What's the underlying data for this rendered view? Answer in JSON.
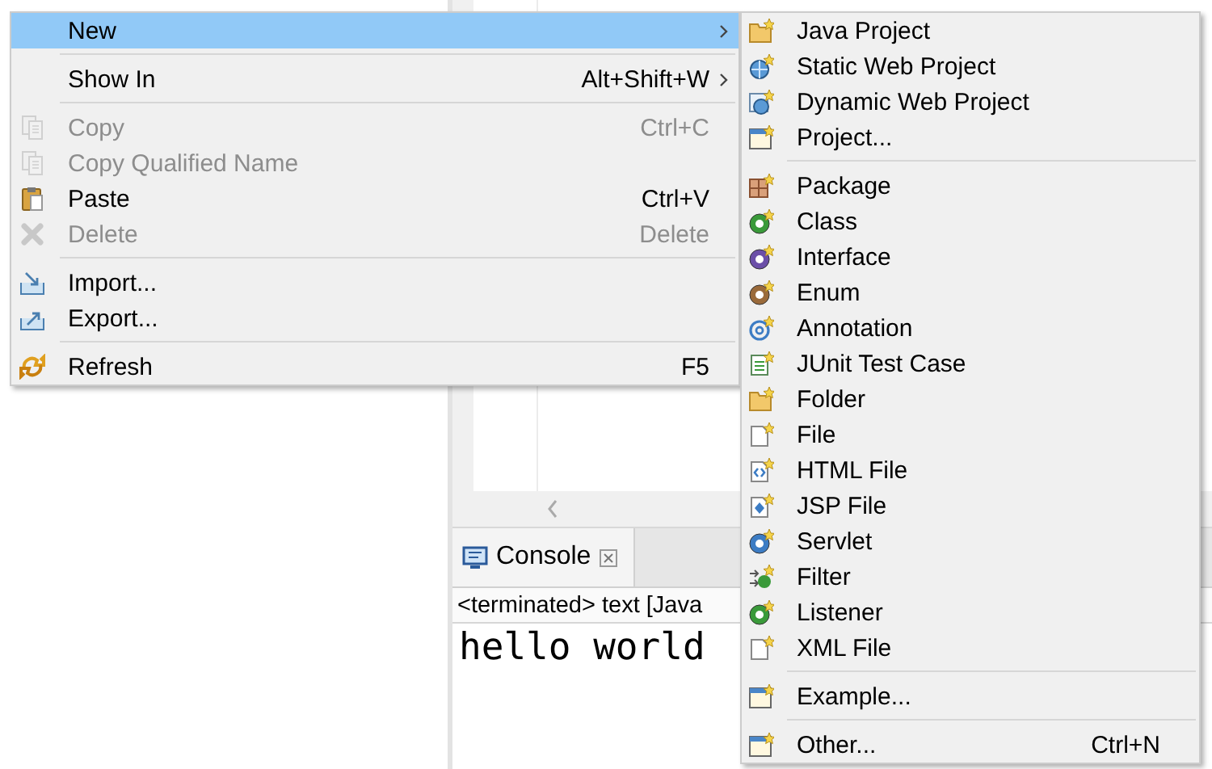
{
  "menu": {
    "items": [
      {
        "kind": "item",
        "label": "New",
        "submenu": true,
        "selected": true,
        "disabled": false
      },
      {
        "kind": "separator"
      },
      {
        "kind": "item",
        "label": "Show In",
        "shortcut": "Alt+Shift+W",
        "submenu": true,
        "selected": false,
        "disabled": false
      },
      {
        "kind": "separator"
      },
      {
        "kind": "item",
        "label": "Copy",
        "shortcut": "Ctrl+C",
        "submenu": false,
        "selected": false,
        "disabled": true
      },
      {
        "kind": "item",
        "label": "Copy Qualified Name",
        "submenu": false,
        "selected": false,
        "disabled": true
      },
      {
        "kind": "item",
        "label": "Paste",
        "shortcut": "Ctrl+V",
        "submenu": false,
        "selected": false,
        "disabled": false
      },
      {
        "kind": "item",
        "label": "Delete",
        "shortcut": "Delete",
        "submenu": false,
        "selected": false,
        "disabled": true
      },
      {
        "kind": "separator"
      },
      {
        "kind": "item",
        "label": "Import...",
        "submenu": false,
        "selected": false,
        "disabled": false
      },
      {
        "kind": "item",
        "label": "Export...",
        "submenu": false,
        "selected": false,
        "disabled": false
      },
      {
        "kind": "separator"
      },
      {
        "kind": "item",
        "label": "Refresh",
        "shortcut": "F5",
        "submenu": false,
        "selected": false,
        "disabled": false
      }
    ]
  },
  "submenu": {
    "items": [
      {
        "kind": "item",
        "label": "Java Project"
      },
      {
        "kind": "item",
        "label": "Static Web Project"
      },
      {
        "kind": "item",
        "label": "Dynamic Web Project"
      },
      {
        "kind": "item",
        "label": "Project..."
      },
      {
        "kind": "separator"
      },
      {
        "kind": "item",
        "label": "Package"
      },
      {
        "kind": "item",
        "label": "Class"
      },
      {
        "kind": "item",
        "label": "Interface"
      },
      {
        "kind": "item",
        "label": "Enum"
      },
      {
        "kind": "item",
        "label": "Annotation"
      },
      {
        "kind": "item",
        "label": "JUnit Test Case"
      },
      {
        "kind": "item",
        "label": "Folder"
      },
      {
        "kind": "item",
        "label": "File"
      },
      {
        "kind": "item",
        "label": "HTML File"
      },
      {
        "kind": "item",
        "label": "JSP File"
      },
      {
        "kind": "item",
        "label": "Servlet"
      },
      {
        "kind": "item",
        "label": "Filter"
      },
      {
        "kind": "item",
        "label": "Listener"
      },
      {
        "kind": "item",
        "label": "XML File"
      },
      {
        "kind": "separator"
      },
      {
        "kind": "item",
        "label": "Example..."
      },
      {
        "kind": "separator"
      },
      {
        "kind": "item",
        "label": "Other...",
        "shortcut": "Ctrl+N"
      }
    ]
  },
  "console": {
    "tab": {
      "label": "Console",
      "selected": true
    },
    "header": "<terminated> text [Java",
    "output": "hello world"
  }
}
